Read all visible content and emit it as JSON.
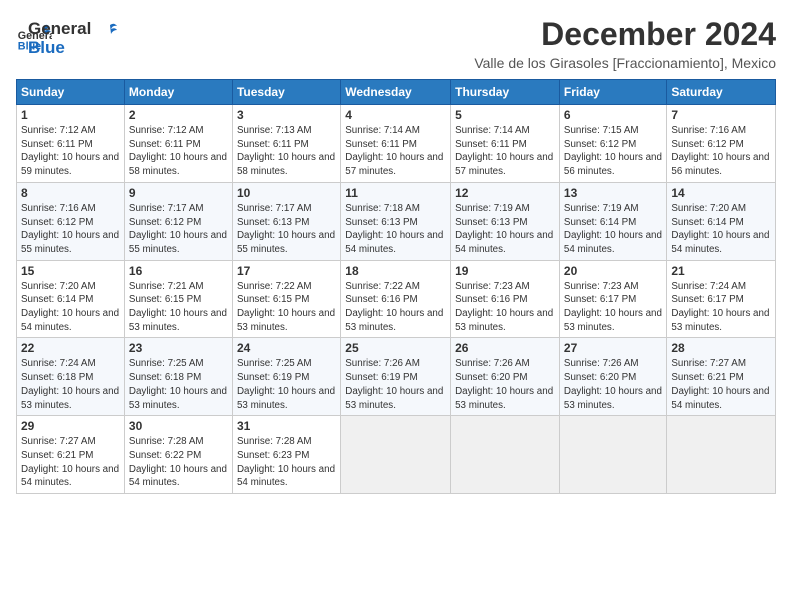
{
  "header": {
    "logo_general": "General",
    "logo_blue": "Blue",
    "month_title": "December 2024",
    "subtitle": "Valle de los Girasoles [Fraccionamiento], Mexico"
  },
  "weekdays": [
    "Sunday",
    "Monday",
    "Tuesday",
    "Wednesday",
    "Thursday",
    "Friday",
    "Saturday"
  ],
  "weeks": [
    [
      {
        "day": "1",
        "sunrise": "7:12 AM",
        "sunset": "6:11 PM",
        "daylight": "10 hours and 59 minutes."
      },
      {
        "day": "2",
        "sunrise": "7:12 AM",
        "sunset": "6:11 PM",
        "daylight": "10 hours and 58 minutes."
      },
      {
        "day": "3",
        "sunrise": "7:13 AM",
        "sunset": "6:11 PM",
        "daylight": "10 hours and 58 minutes."
      },
      {
        "day": "4",
        "sunrise": "7:14 AM",
        "sunset": "6:11 PM",
        "daylight": "10 hours and 57 minutes."
      },
      {
        "day": "5",
        "sunrise": "7:14 AM",
        "sunset": "6:11 PM",
        "daylight": "10 hours and 57 minutes."
      },
      {
        "day": "6",
        "sunrise": "7:15 AM",
        "sunset": "6:12 PM",
        "daylight": "10 hours and 56 minutes."
      },
      {
        "day": "7",
        "sunrise": "7:16 AM",
        "sunset": "6:12 PM",
        "daylight": "10 hours and 56 minutes."
      }
    ],
    [
      {
        "day": "8",
        "sunrise": "7:16 AM",
        "sunset": "6:12 PM",
        "daylight": "10 hours and 55 minutes."
      },
      {
        "day": "9",
        "sunrise": "7:17 AM",
        "sunset": "6:12 PM",
        "daylight": "10 hours and 55 minutes."
      },
      {
        "day": "10",
        "sunrise": "7:17 AM",
        "sunset": "6:13 PM",
        "daylight": "10 hours and 55 minutes."
      },
      {
        "day": "11",
        "sunrise": "7:18 AM",
        "sunset": "6:13 PM",
        "daylight": "10 hours and 54 minutes."
      },
      {
        "day": "12",
        "sunrise": "7:19 AM",
        "sunset": "6:13 PM",
        "daylight": "10 hours and 54 minutes."
      },
      {
        "day": "13",
        "sunrise": "7:19 AM",
        "sunset": "6:14 PM",
        "daylight": "10 hours and 54 minutes."
      },
      {
        "day": "14",
        "sunrise": "7:20 AM",
        "sunset": "6:14 PM",
        "daylight": "10 hours and 54 minutes."
      }
    ],
    [
      {
        "day": "15",
        "sunrise": "7:20 AM",
        "sunset": "6:14 PM",
        "daylight": "10 hours and 54 minutes."
      },
      {
        "day": "16",
        "sunrise": "7:21 AM",
        "sunset": "6:15 PM",
        "daylight": "10 hours and 53 minutes."
      },
      {
        "day": "17",
        "sunrise": "7:22 AM",
        "sunset": "6:15 PM",
        "daylight": "10 hours and 53 minutes."
      },
      {
        "day": "18",
        "sunrise": "7:22 AM",
        "sunset": "6:16 PM",
        "daylight": "10 hours and 53 minutes."
      },
      {
        "day": "19",
        "sunrise": "7:23 AM",
        "sunset": "6:16 PM",
        "daylight": "10 hours and 53 minutes."
      },
      {
        "day": "20",
        "sunrise": "7:23 AM",
        "sunset": "6:17 PM",
        "daylight": "10 hours and 53 minutes."
      },
      {
        "day": "21",
        "sunrise": "7:24 AM",
        "sunset": "6:17 PM",
        "daylight": "10 hours and 53 minutes."
      }
    ],
    [
      {
        "day": "22",
        "sunrise": "7:24 AM",
        "sunset": "6:18 PM",
        "daylight": "10 hours and 53 minutes."
      },
      {
        "day": "23",
        "sunrise": "7:25 AM",
        "sunset": "6:18 PM",
        "daylight": "10 hours and 53 minutes."
      },
      {
        "day": "24",
        "sunrise": "7:25 AM",
        "sunset": "6:19 PM",
        "daylight": "10 hours and 53 minutes."
      },
      {
        "day": "25",
        "sunrise": "7:26 AM",
        "sunset": "6:19 PM",
        "daylight": "10 hours and 53 minutes."
      },
      {
        "day": "26",
        "sunrise": "7:26 AM",
        "sunset": "6:20 PM",
        "daylight": "10 hours and 53 minutes."
      },
      {
        "day": "27",
        "sunrise": "7:26 AM",
        "sunset": "6:20 PM",
        "daylight": "10 hours and 53 minutes."
      },
      {
        "day": "28",
        "sunrise": "7:27 AM",
        "sunset": "6:21 PM",
        "daylight": "10 hours and 54 minutes."
      }
    ],
    [
      {
        "day": "29",
        "sunrise": "7:27 AM",
        "sunset": "6:21 PM",
        "daylight": "10 hours and 54 minutes."
      },
      {
        "day": "30",
        "sunrise": "7:28 AM",
        "sunset": "6:22 PM",
        "daylight": "10 hours and 54 minutes."
      },
      {
        "day": "31",
        "sunrise": "7:28 AM",
        "sunset": "6:23 PM",
        "daylight": "10 hours and 54 minutes."
      },
      null,
      null,
      null,
      null
    ]
  ],
  "labels": {
    "sunrise_prefix": "Sunrise: ",
    "sunset_prefix": "Sunset: ",
    "daylight_prefix": "Daylight: "
  }
}
